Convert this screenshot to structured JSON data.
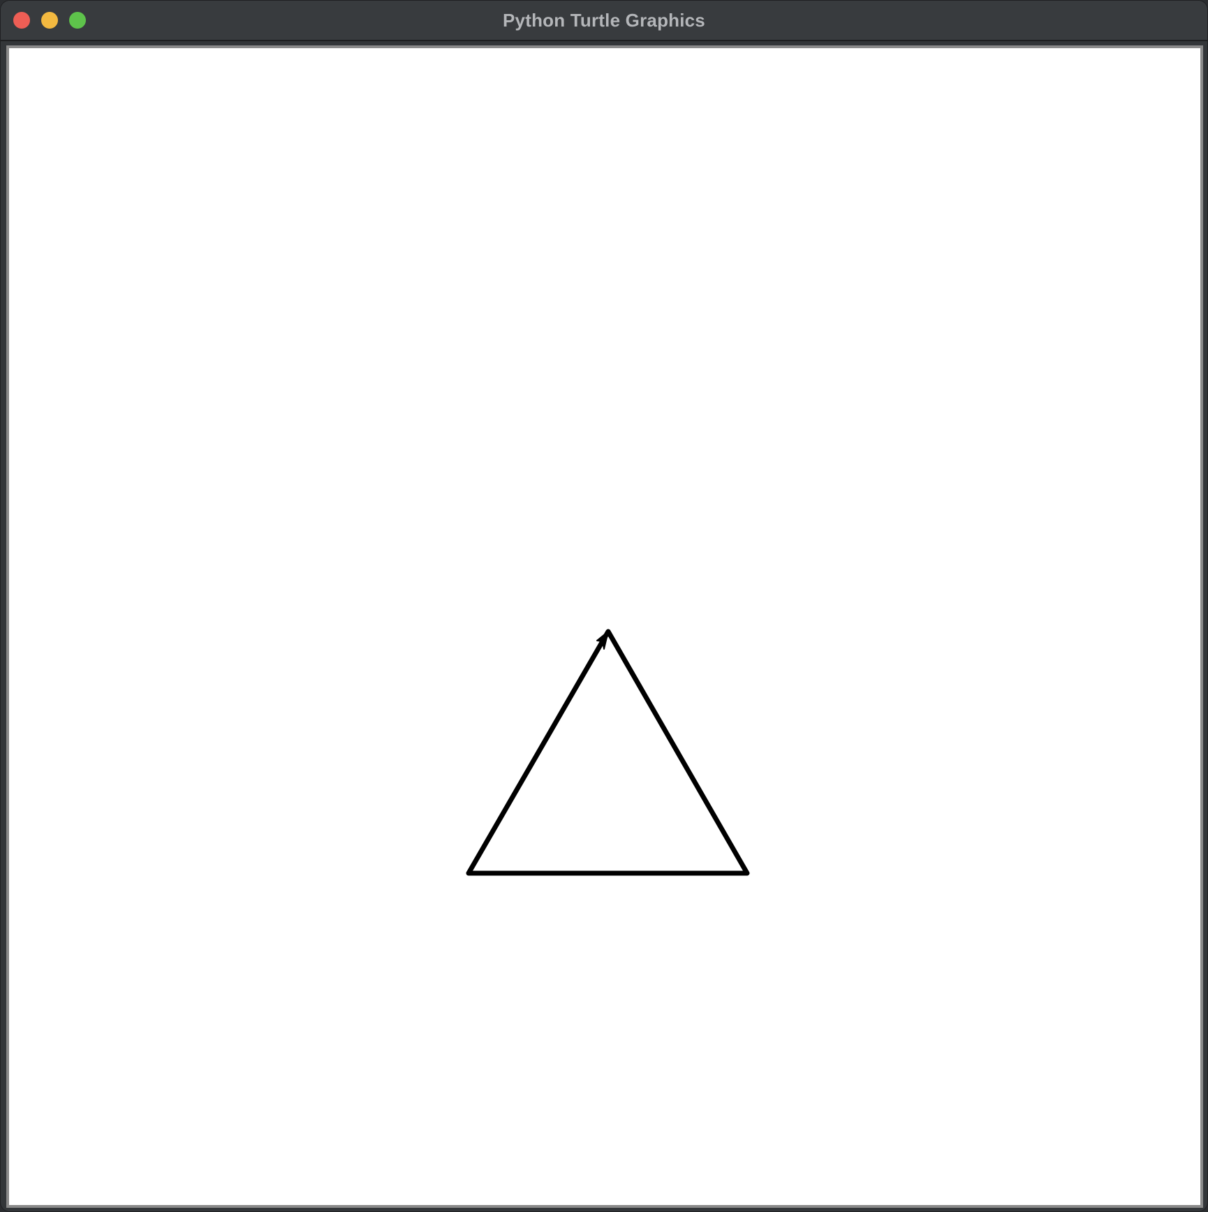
{
  "window": {
    "title": "Python Turtle Graphics",
    "controls": {
      "close_color": "#ee5e55",
      "minimize_color": "#f3b940",
      "zoom_color": "#5ec34b"
    }
  },
  "canvas": {
    "background": "#ffffff",
    "pen_color": "#000000",
    "shape": "triangle",
    "turtle": {
      "shape": "arrow",
      "heading": "up-right"
    }
  }
}
